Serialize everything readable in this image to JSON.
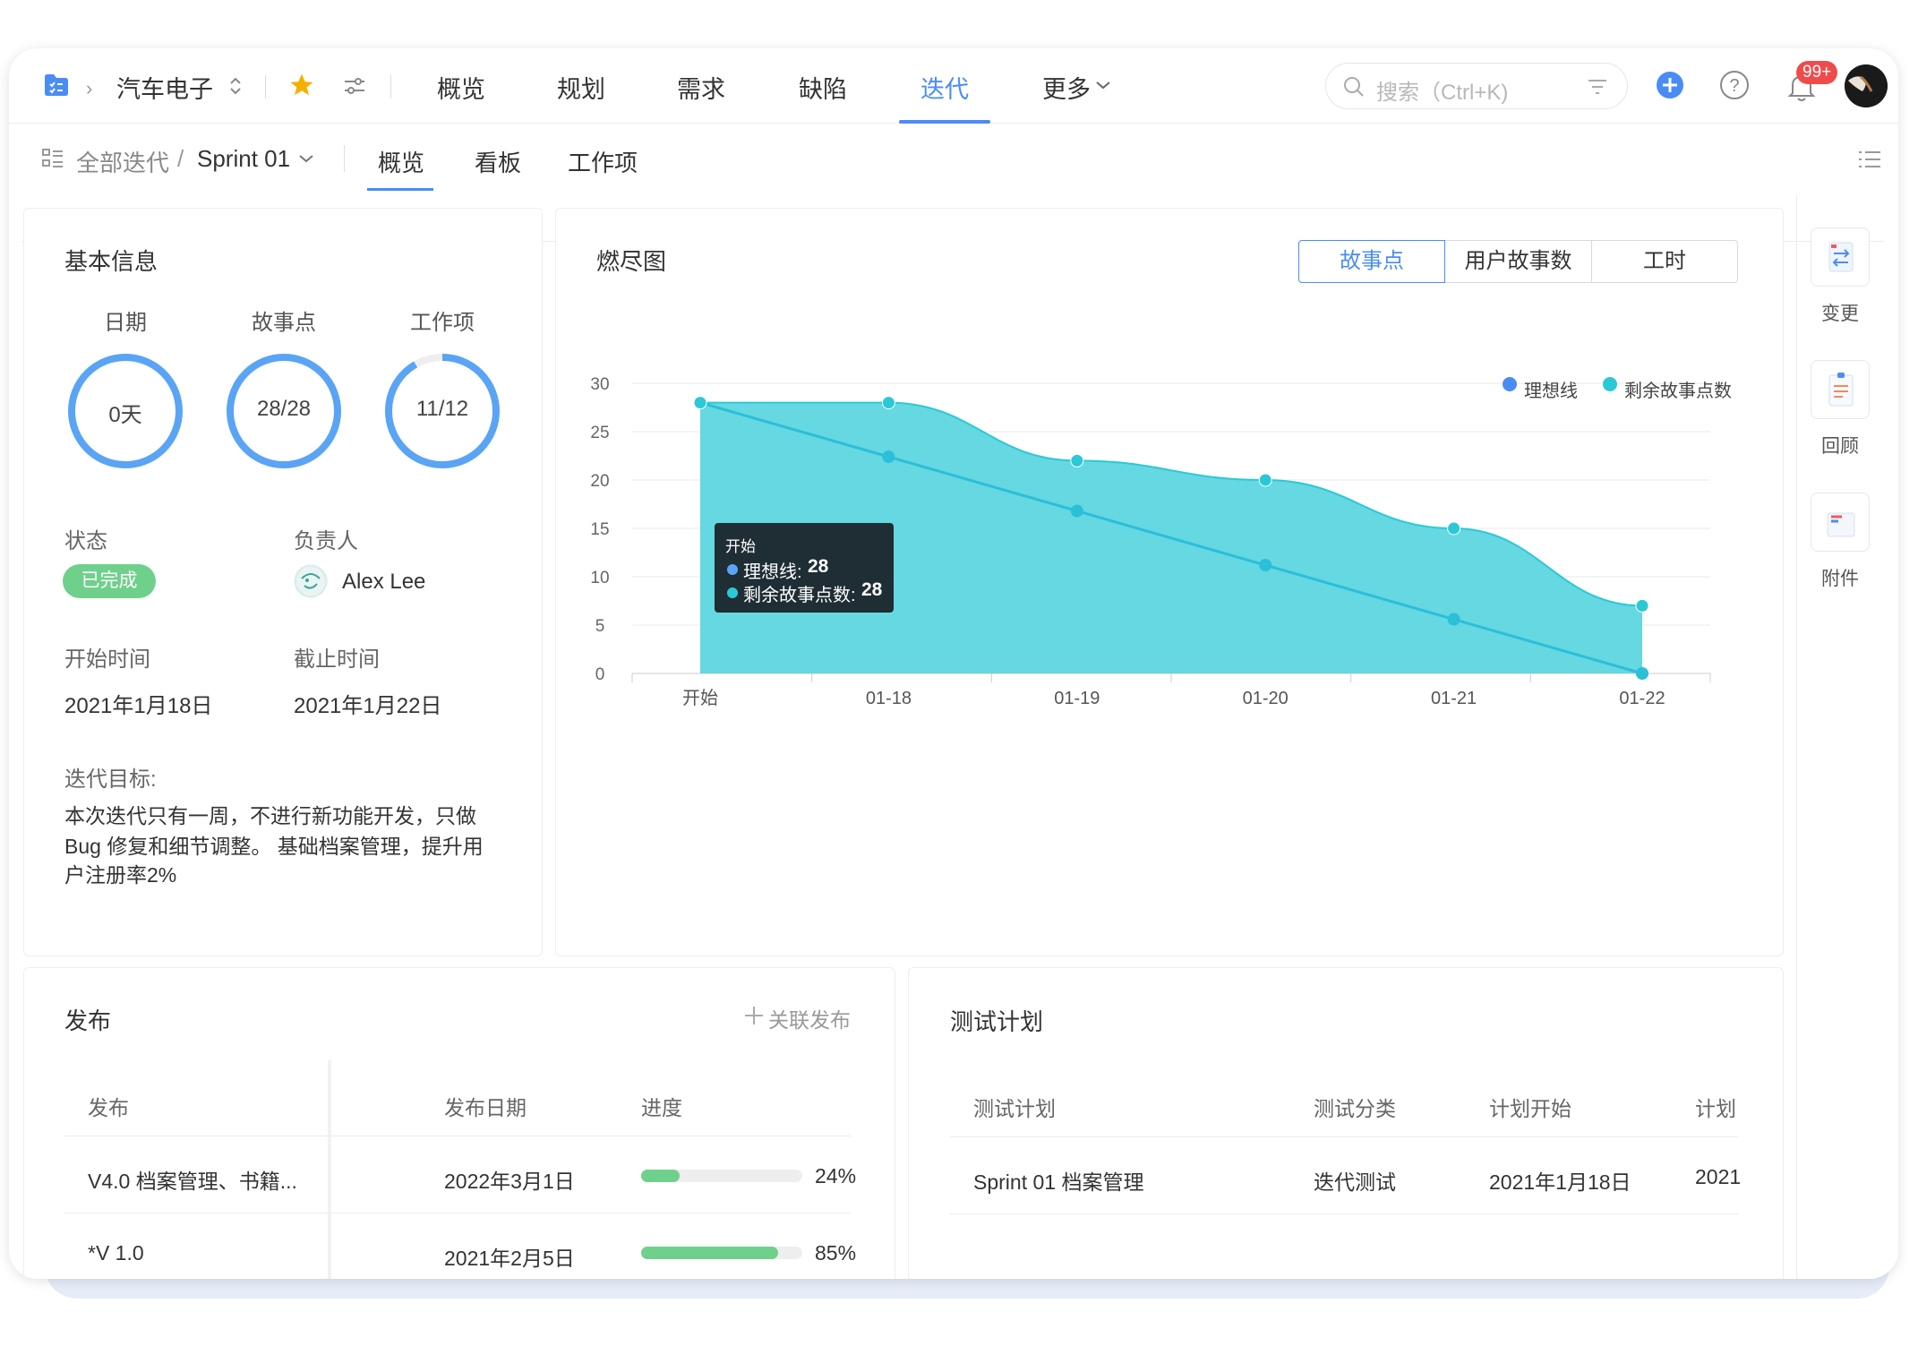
{
  "header": {
    "project": "汽车电子",
    "nav": [
      "概览",
      "规划",
      "需求",
      "缺陷",
      "迭代",
      "更多"
    ],
    "active_nav": "迭代",
    "search_placeholder": "搜索（Ctrl+K)",
    "notification_badge": "99+"
  },
  "subnav": {
    "all_iterations": "全部迭代",
    "separator": "/",
    "sprint": "Sprint 01",
    "tabs": [
      "概览",
      "看板",
      "工作项"
    ],
    "active_tab": "概览"
  },
  "basic_info": {
    "title": "基本信息",
    "rings": [
      {
        "label": "日期",
        "value": "0天",
        "fraction": 1.0
      },
      {
        "label": "故事点",
        "value": "28/28",
        "fraction": 1.0
      },
      {
        "label": "工作项",
        "value": "11/12",
        "fraction": 0.9167
      }
    ],
    "status_label": "状态",
    "status_value": "已完成",
    "owner_label": "负责人",
    "owner_name": "Alex Lee",
    "start_label": "开始时间",
    "start_value": "2021年1月18日",
    "end_label": "截止时间",
    "end_value": "2021年1月22日",
    "goal_label": "迭代目标:",
    "goal_lines": [
      "本次迭代只有一周，不进行新功能开发，只做",
      "Bug 修复和细节调整。 基础档案管理，提升用",
      "户注册率2%"
    ]
  },
  "burndown": {
    "title": "燃尽图",
    "segments": [
      "故事点",
      "用户故事数",
      "工时"
    ],
    "active_segment": "故事点",
    "tooltip": {
      "title": "开始",
      "ideal_label": "理想线:",
      "ideal_value": "28",
      "remaining_label": "剩余故事点数:",
      "remaining_value": "28"
    }
  },
  "chart_data": {
    "type": "area",
    "categories": [
      "开始",
      "01-18",
      "01-19",
      "01-20",
      "01-21",
      "01-22"
    ],
    "series": [
      {
        "name": "理想线",
        "values": [
          28,
          22.4,
          16.8,
          11.2,
          5.6,
          0
        ],
        "color": "#2bbfd8"
      },
      {
        "name": "剩余故事点数",
        "values": [
          28,
          28,
          22,
          20,
          15,
          7
        ],
        "color": "#5dd6e0"
      }
    ],
    "xlabel": "",
    "ylabel": "",
    "ylim": [
      0,
      30
    ],
    "yticks": [
      "0",
      "5",
      "10",
      "15",
      "20",
      "25",
      "30"
    ],
    "grid": true,
    "legend": "top-right"
  },
  "release": {
    "title": "发布",
    "link_action": "关联发布",
    "columns": [
      "发布",
      "发布日期",
      "进度"
    ],
    "rows": [
      {
        "name": "V4.0 档案管理、书籍...",
        "date": "2022年3月1日",
        "progress": 24,
        "progress_text": "24%"
      },
      {
        "name": "*V 1.0",
        "date": "2021年2月5日",
        "progress": 85,
        "progress_text": "85%"
      }
    ]
  },
  "test_plan": {
    "title": "测试计划",
    "columns": [
      "测试计划",
      "测试分类",
      "计划开始",
      "计划"
    ],
    "rows": [
      {
        "name": "Sprint 01 档案管理",
        "category": "迭代测试",
        "start": "2021年1月18日",
        "end": "2021"
      }
    ]
  },
  "side_actions": [
    "变更",
    "回顾",
    "附件"
  ],
  "colors": {
    "accent": "#4a8cf6",
    "ring": "#5aa4f5",
    "area": "#5dd6e0",
    "ideal": "#2bbfd8",
    "success": "#6fd08c"
  }
}
